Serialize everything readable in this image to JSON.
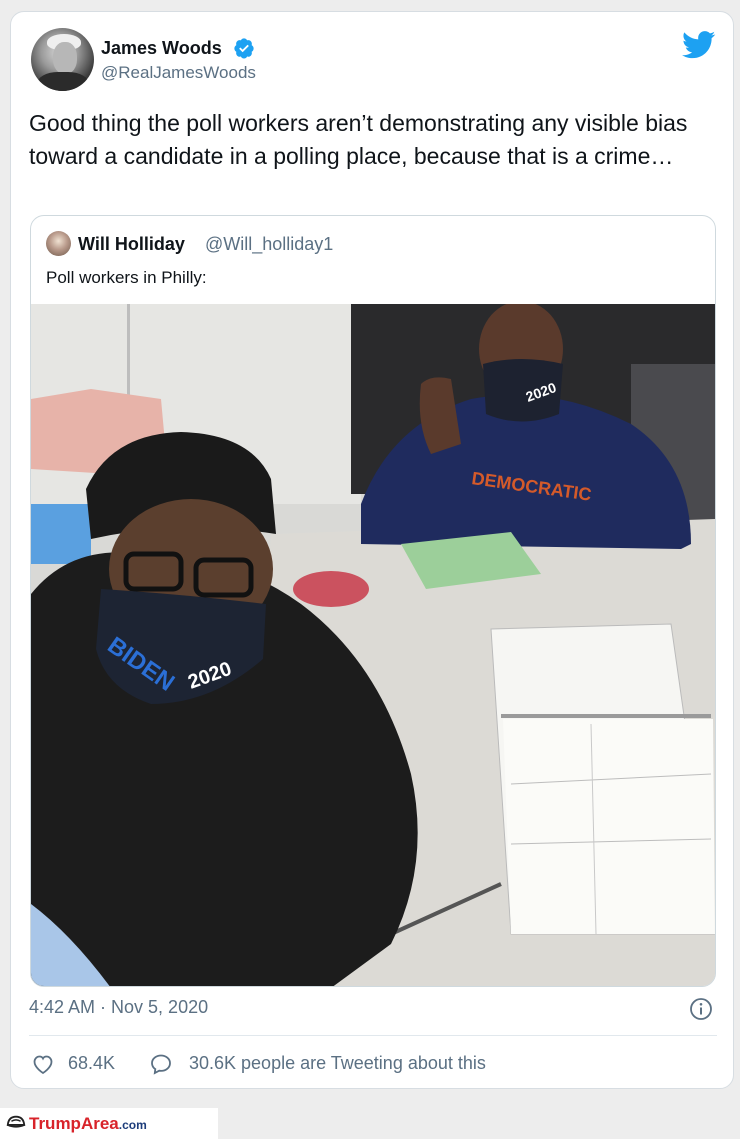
{
  "tweet": {
    "author_name": "James Woods",
    "author_handle": "@RealJamesWoods",
    "text": "Good thing the poll workers aren’t demonstrating any visible bias toward a candidate in a polling place, because that is a crime…",
    "timestamp": "4:42 AM · Nov 5, 2020",
    "likes": "68.4K",
    "retweets_text": "30.6K people are Tweeting about this"
  },
  "quoted_tweet": {
    "author_name": "Will Holliday",
    "author_handle": "@Will_holliday1",
    "text": "Poll workers in Philly:",
    "photo_mask_text_1": "BIDEN",
    "photo_mask_text_2": "2020"
  },
  "footer": {
    "brand_name": "TrumpArea",
    "brand_domain": ".com"
  },
  "icons": {
    "verified": "verified-badge-icon",
    "platform": "twitter-bird-icon",
    "info": "info-icon",
    "like": "heart-icon",
    "reply": "chat-bubble-icon"
  },
  "colors": {
    "verified_blue": "#1da1f2",
    "secondary_text": "#5b7083",
    "brand_red": "#d8232a"
  }
}
